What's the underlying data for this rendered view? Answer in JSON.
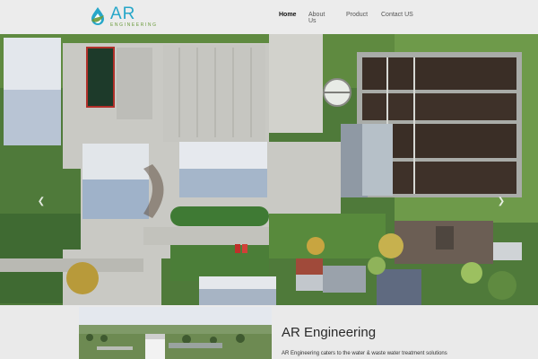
{
  "brand": {
    "name": "AR",
    "tagline": "ENGINEERING",
    "primary_color": "#27a7c9",
    "secondary_color": "#6a9a3a"
  },
  "nav": {
    "items": [
      {
        "label": "Home",
        "active": true
      },
      {
        "label": "About Us",
        "active": false
      },
      {
        "label": "Product",
        "active": false
      },
      {
        "label": "Contact US",
        "active": false
      }
    ]
  },
  "hero": {
    "image": "aerial-view-of-water-treatment-plant",
    "prev_icon": "chevron-left-icon",
    "next_icon": "chevron-right-icon"
  },
  "about": {
    "title": "AR Engineering",
    "description": "AR Engineering caters to the water & waste water treatment solutions",
    "thumbnail": "treatment-facility-photo"
  }
}
